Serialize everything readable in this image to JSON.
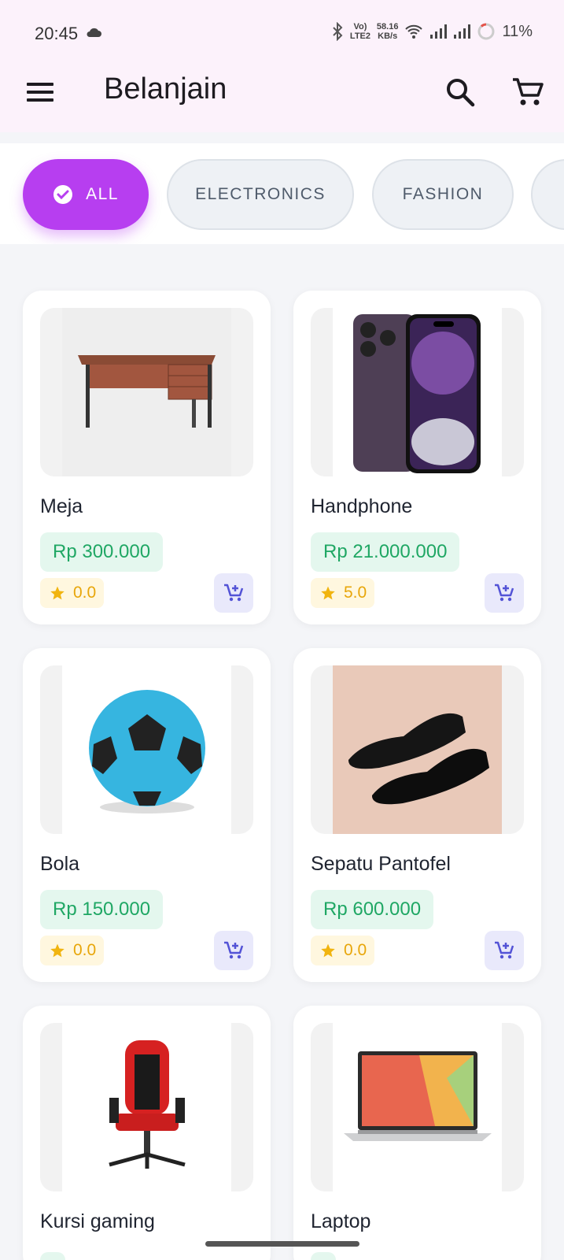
{
  "status_bar": {
    "time": "20:45",
    "net_speed_value": "58.16",
    "net_speed_unit": "KB/s",
    "volte": "Vo) LTE2",
    "battery": "11%"
  },
  "app_bar": {
    "title": "Belanjain"
  },
  "filters": [
    {
      "label": "ALL",
      "selected": true
    },
    {
      "label": "ELECTRONICS",
      "selected": false
    },
    {
      "label": "FASHION",
      "selected": false
    }
  ],
  "products": [
    {
      "name": "Meja",
      "price": "Rp 300.000",
      "rating": "0.0"
    },
    {
      "name": "Handphone",
      "price": "Rp 21.000.000",
      "rating": "5.0"
    },
    {
      "name": "Bola",
      "price": "Rp 150.000",
      "rating": "0.0"
    },
    {
      "name": "Sepatu Pantofel",
      "price": "Rp 600.000",
      "rating": "0.0"
    },
    {
      "name": "Kursi gaming",
      "price": "",
      "rating": ""
    },
    {
      "name": "Laptop",
      "price": "",
      "rating": ""
    }
  ],
  "colors": {
    "accent": "#b73ef0",
    "price_text": "#1fa764",
    "rating_text": "#e8a60a",
    "cart_icon": "#5353d6"
  }
}
